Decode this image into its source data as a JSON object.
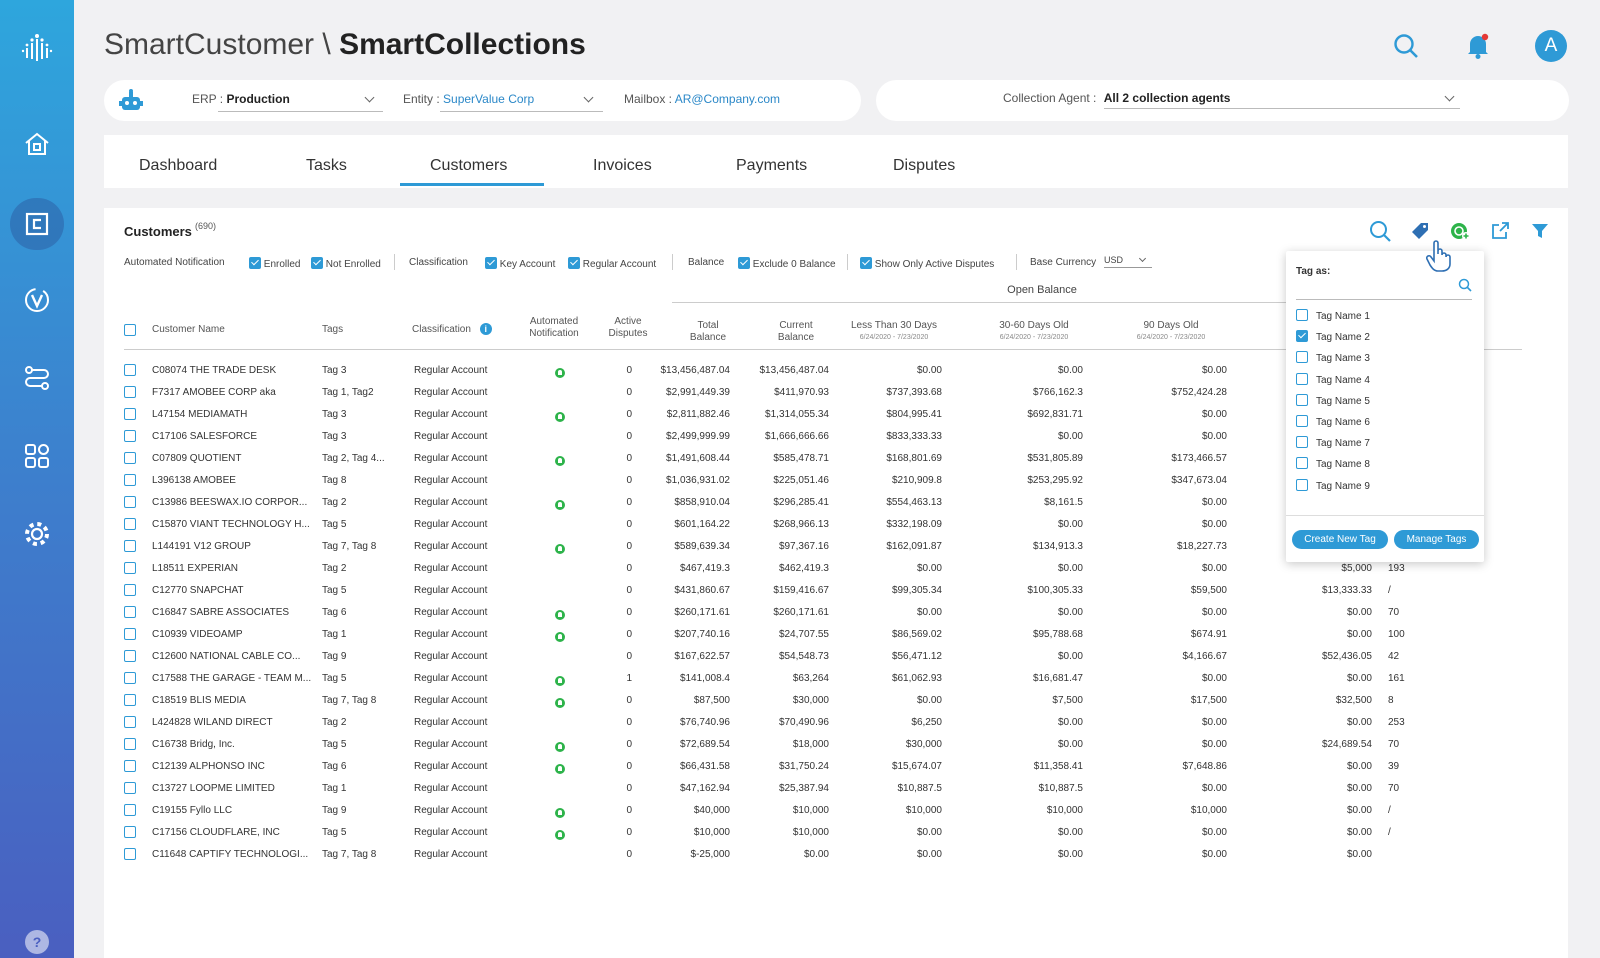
{
  "header": {
    "app_name": "SmartCustomer \\ ",
    "module_name": "SmartCollections",
    "avatar_initial": "A"
  },
  "context": {
    "erp_label": "ERP :",
    "erp_value": "Production",
    "entity_label": "Entity :",
    "entity_value": "SuperValue Corp",
    "mailbox_label": "Mailbox :",
    "mailbox_value": "AR@Company.com",
    "agent_label": "Collection Agent :",
    "agent_value": "All 2 collection agents"
  },
  "tabs": [
    {
      "label": "Dashboard"
    },
    {
      "label": "Tasks"
    },
    {
      "label": "Customers",
      "active": true
    },
    {
      "label": "Invoices"
    },
    {
      "label": "Payments"
    },
    {
      "label": "Disputes"
    }
  ],
  "panel": {
    "title": "Customers",
    "count": "(690)"
  },
  "filters": {
    "automated_notification": "Automated Notification",
    "enrolled": "Enrolled",
    "not_enrolled": "Not Enrolled",
    "classification": "Classification",
    "key_account": "Key Account",
    "regular_account": "Regular Account",
    "balance": "Balance",
    "exclude_zero": "Exclude 0 Balance",
    "active_disputes": "Show Only Active Disputes",
    "base_currency": "Base Currency",
    "currency": "USD"
  },
  "table": {
    "group_header": "Open Balance",
    "columns": {
      "name": "Customer Name",
      "tags": "Tags",
      "classification": "Classification",
      "notif_1": "Automated",
      "notif_2": "Notification",
      "disputes_1": "Active",
      "disputes_2": "Disputes",
      "total_1": "Total",
      "total_2": "Balance",
      "current_1": "Current",
      "current_2": "Balance",
      "lt30": "Less Than 30 Days",
      "lt30_sub": "6/24/2020 - 7/23/2020",
      "d3060": "30-60 Days Old",
      "d3060_sub": "6/24/2020 - 7/23/2020",
      "d90": "90 Days Old",
      "d90_sub": "6/24/2020 - 7/23/2020"
    },
    "rows": [
      {
        "name": "C08074 THE TRADE DESK",
        "tags": "Tag 3",
        "cls": "Regular Account",
        "notif": true,
        "disp": "0",
        "total": "$13,456,487.04",
        "current": "$13,456,487.04",
        "lt30": "$0.00",
        "d3060": "$0.00",
        "d90": "$0.00",
        "extra": "",
        "days": ""
      },
      {
        "name": "F7317 AMOBEE CORP aka",
        "tags": "Tag 1, Tag2",
        "cls": "Regular Account",
        "notif": false,
        "disp": "0",
        "total": "$2,991,449.39",
        "current": "$411,970.93",
        "lt30": "$737,393.68",
        "d3060": "$766,162.3",
        "d90": "$752,424.28",
        "extra": "",
        "days": ""
      },
      {
        "name": "L47154 MEDIAMATH",
        "tags": "Tag 3",
        "cls": "Regular Account",
        "notif": true,
        "disp": "0",
        "total": "$2,811,882.46",
        "current": "$1,314,055.34",
        "lt30": "$804,995.41",
        "d3060": "$692,831.71",
        "d90": "$0.00",
        "extra": "",
        "days": ""
      },
      {
        "name": "C17106 SALESFORCE",
        "tags": "Tag 3",
        "cls": "Regular Account",
        "notif": false,
        "disp": "0",
        "total": "$2,499,999.99",
        "current": "$1,666,666.66",
        "lt30": "$833,333.33",
        "d3060": "$0.00",
        "d90": "$0.00",
        "extra": "",
        "days": ""
      },
      {
        "name": "C07809 QUOTIENT",
        "tags": "Tag 2, Tag 4...",
        "cls": "Regular Account",
        "notif": true,
        "disp": "0",
        "total": "$1,491,608.44",
        "current": "$585,478.71",
        "lt30": "$168,801.69",
        "d3060": "$531,805.89",
        "d90": "$173,466.57",
        "extra": "",
        "days": ""
      },
      {
        "name": "L396138 AMOBEE",
        "tags": "Tag 8",
        "cls": "Regular Account",
        "notif": false,
        "disp": "0",
        "total": "$1,036,931.02",
        "current": "$225,051.46",
        "lt30": "$210,909.8",
        "d3060": "$253,295.92",
        "d90": "$347,673.04",
        "extra": "",
        "days": ""
      },
      {
        "name": "C13986 BEESWAX.IO CORPOR...",
        "tags": "Tag 2",
        "cls": "Regular Account",
        "notif": true,
        "disp": "0",
        "total": "$858,910.04",
        "current": "$296,285.41",
        "lt30": "$554,463.13",
        "d3060": "$8,161.5",
        "d90": "$0.00",
        "extra": "",
        "days": ""
      },
      {
        "name": "C15870 VIANT TECHNOLOGY H...",
        "tags": "Tag 5",
        "cls": "Regular Account",
        "notif": false,
        "disp": "0",
        "total": "$601,164.22",
        "current": "$268,966.13",
        "lt30": "$332,198.09",
        "d3060": "$0.00",
        "d90": "$0.00",
        "extra": "",
        "days": ""
      },
      {
        "name": "L144191 V12 GROUP",
        "tags": "Tag 7, Tag 8",
        "cls": "Regular Account",
        "notif": true,
        "disp": "0",
        "total": "$589,639.34",
        "current": "$97,367.16",
        "lt30": "$162,091.87",
        "d3060": "$134,913.3",
        "d90": "$18,227.73",
        "extra": "",
        "days": ""
      },
      {
        "name": "L18511 EXPERIAN",
        "tags": "Tag 2",
        "cls": "Regular Account",
        "notif": false,
        "disp": "0",
        "total": "$467,419.3",
        "current": "$462,419.3",
        "lt30": "$0.00",
        "d3060": "$0.00",
        "d90": "$0.00",
        "extra": "$5,000",
        "days": "193"
      },
      {
        "name": "C12770 SNAPCHAT",
        "tags": "Tag 5",
        "cls": "Regular Account",
        "notif": false,
        "disp": "0",
        "total": "$431,860.67",
        "current": "$159,416.67",
        "lt30": "$99,305.34",
        "d3060": "$100,305.33",
        "d90": "$59,500",
        "extra": "$13,333.33",
        "days": "/"
      },
      {
        "name": "C16847 SABRE ASSOCIATES",
        "tags": "Tag 6",
        "cls": "Regular Account",
        "notif": true,
        "disp": "0",
        "total": "$260,171.61",
        "current": "$260,171.61",
        "lt30": "$0.00",
        "d3060": "$0.00",
        "d90": "$0.00",
        "extra": "$0.00",
        "days": "70"
      },
      {
        "name": "C10939 VIDEOAMP",
        "tags": "Tag 1",
        "cls": "Regular Account",
        "notif": true,
        "disp": "0",
        "total": "$207,740.16",
        "current": "$24,707.55",
        "lt30": "$86,569.02",
        "d3060": "$95,788.68",
        "d90": "$674.91",
        "extra": "$0.00",
        "days": "100"
      },
      {
        "name": "C12600 NATIONAL CABLE CO...",
        "tags": "Tag 9",
        "cls": "Regular Account",
        "notif": false,
        "disp": "0",
        "total": "$167,622.57",
        "current": "$54,548.73",
        "lt30": "$56,471.12",
        "d3060": "$0.00",
        "d90": "$4,166.67",
        "extra": "$52,436.05",
        "days": "42"
      },
      {
        "name": "C17588 THE GARAGE - TEAM M...",
        "tags": "Tag 5",
        "cls": "Regular Account",
        "notif": true,
        "disp": "1",
        "total": "$141,008.4",
        "current": "$63,264",
        "lt30": "$61,062.93",
        "d3060": "$16,681.47",
        "d90": "$0.00",
        "extra": "$0.00",
        "days": "161"
      },
      {
        "name": "C18519 BLIS MEDIA",
        "tags": "Tag 7, Tag 8",
        "cls": "Regular Account",
        "notif": true,
        "disp": "0",
        "total": "$87,500",
        "current": "$30,000",
        "lt30": "$0.00",
        "d3060": "$7,500",
        "d90": "$17,500",
        "extra": "$32,500",
        "days": "8"
      },
      {
        "name": "L424828 WILAND DIRECT",
        "tags": "Tag 2",
        "cls": "Regular Account",
        "notif": false,
        "disp": "0",
        "total": "$76,740.96",
        "current": "$70,490.96",
        "lt30": "$6,250",
        "d3060": "$0.00",
        "d90": "$0.00",
        "extra": "$0.00",
        "days": "253"
      },
      {
        "name": "C16738 Bridg, Inc.",
        "tags": "Tag 5",
        "cls": "Regular Account",
        "notif": true,
        "disp": "0",
        "total": "$72,689.54",
        "current": "$18,000",
        "lt30": "$30,000",
        "d3060": "$0.00",
        "d90": "$0.00",
        "extra": "$24,689.54",
        "days": "70"
      },
      {
        "name": "C12139 ALPHONSO INC",
        "tags": "Tag 6",
        "cls": "Regular Account",
        "notif": true,
        "disp": "0",
        "total": "$66,431.58",
        "current": "$31,750.24",
        "lt30": "$15,674.07",
        "d3060": "$11,358.41",
        "d90": "$7,648.86",
        "extra": "$0.00",
        "days": "39"
      },
      {
        "name": "C13727 LOOPME LIMITED",
        "tags": "Tag 1",
        "cls": "Regular Account",
        "notif": false,
        "disp": "0",
        "total": "$47,162.94",
        "current": "$25,387.94",
        "lt30": "$10,887.5",
        "d3060": "$10,887.5",
        "d90": "$0.00",
        "extra": "$0.00",
        "days": "70"
      },
      {
        "name": "C19155 Fyllo LLC",
        "tags": "Tag 9",
        "cls": "Regular Account",
        "notif": true,
        "disp": "0",
        "total": "$40,000",
        "current": "$10,000",
        "lt30": "$10,000",
        "d3060": "$10,000",
        "d90": "$10,000",
        "extra": "$0.00",
        "days": "/"
      },
      {
        "name": "C17156 CLOUDFLARE, INC",
        "tags": "Tag 5",
        "cls": "Regular Account",
        "notif": true,
        "disp": "0",
        "total": "$10,000",
        "current": "$10,000",
        "lt30": "$0.00",
        "d3060": "$0.00",
        "d90": "$0.00",
        "extra": "$0.00",
        "days": "/"
      },
      {
        "name": "C11648 CAPTIFY TECHNOLOGI...",
        "tags": "Tag 7, Tag 8",
        "cls": "Regular Account",
        "notif": false,
        "disp": "0",
        "total": "$-25,000",
        "current": "$0.00",
        "lt30": "$0.00",
        "d3060": "$0.00",
        "d90": "$0.00",
        "extra": "$0.00",
        "days": ""
      }
    ]
  },
  "tag_popup": {
    "title": "Tag as:",
    "tags": [
      {
        "label": "Tag Name 1",
        "checked": false
      },
      {
        "label": "Tag Name 2",
        "checked": true
      },
      {
        "label": "Tag Name 3",
        "checked": false
      },
      {
        "label": "Tag Name 4",
        "checked": false
      },
      {
        "label": "Tag Name 5",
        "checked": false
      },
      {
        "label": "Tag Name 6",
        "checked": false
      },
      {
        "label": "Tag Name 7",
        "checked": false
      },
      {
        "label": "Tag Name 8",
        "checked": false
      },
      {
        "label": "Tag Name 9",
        "checked": false
      }
    ],
    "create_label": "Create New Tag",
    "manage_label": "Manage Tags"
  },
  "colors": {
    "accent": "#2e9ad6",
    "enrolled_green": "#2db34a",
    "notification_dot": "#e53935"
  },
  "icons": {
    "header": [
      "search-icon",
      "bell-icon"
    ],
    "toolbar": [
      "search-icon",
      "tag-icon",
      "add-circle-icon",
      "export-icon",
      "filter-icon"
    ],
    "sidebar": [
      "logo-icon",
      "home-icon",
      "collections-icon",
      "verify-icon",
      "workflow-icon",
      "apps-icon",
      "settings-icon",
      "help-icon"
    ]
  }
}
